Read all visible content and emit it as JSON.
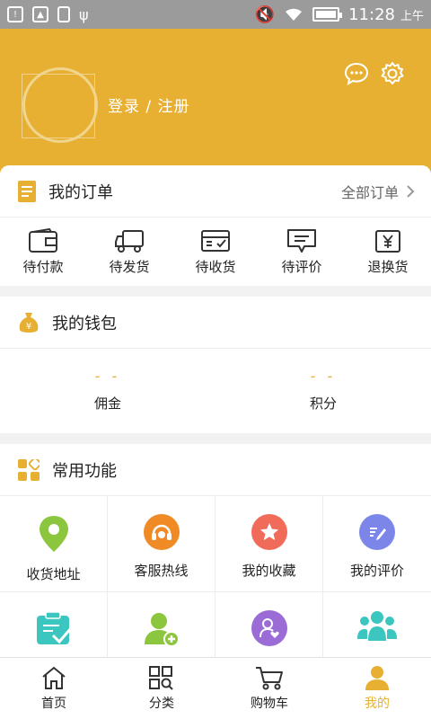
{
  "statusbar": {
    "time": "11:28",
    "ampm": "上午"
  },
  "header": {
    "login_text": "登录 / 注册"
  },
  "orders": {
    "title": "我的订单",
    "all_label": "全部订单",
    "items": [
      {
        "label": "待付款",
        "icon": "wallet-icon"
      },
      {
        "label": "待发货",
        "icon": "truck-icon"
      },
      {
        "label": "待收货",
        "icon": "received-box-icon"
      },
      {
        "label": "待评价",
        "icon": "comment-icon"
      },
      {
        "label": "退换货",
        "icon": "yen-return-icon"
      }
    ]
  },
  "wallet": {
    "title": "我的钱包",
    "items": [
      {
        "value": "- -",
        "label": "佣金"
      },
      {
        "value": "- -",
        "label": "积分"
      }
    ]
  },
  "features": {
    "title": "常用功能",
    "items": [
      {
        "label": "收货地址",
        "color": "#8cc63f",
        "icon": "location-pin-icon"
      },
      {
        "label": "客服热线",
        "color": "#f08a24",
        "icon": "headset-icon"
      },
      {
        "label": "我的收藏",
        "color": "#f06b5a",
        "icon": "star-icon"
      },
      {
        "label": "我的评价",
        "color": "#7b86e8",
        "icon": "edit-icon"
      },
      {
        "label": "",
        "color": "#3cc6c0",
        "icon": "clipboard-check-icon"
      },
      {
        "label": "",
        "color": "#8cc63f",
        "icon": "add-user-icon"
      },
      {
        "label": "",
        "color": "#9b6bd6",
        "icon": "user-heart-icon"
      },
      {
        "label": "",
        "color": "#3cc6c0",
        "icon": "team-icon"
      }
    ]
  },
  "nav": [
    {
      "label": "首页",
      "icon": "home-icon"
    },
    {
      "label": "分类",
      "icon": "category-icon"
    },
    {
      "label": "购物车",
      "icon": "cart-icon"
    },
    {
      "label": "我的",
      "icon": "profile-icon"
    }
  ],
  "colors": {
    "accent": "#e7b032"
  }
}
